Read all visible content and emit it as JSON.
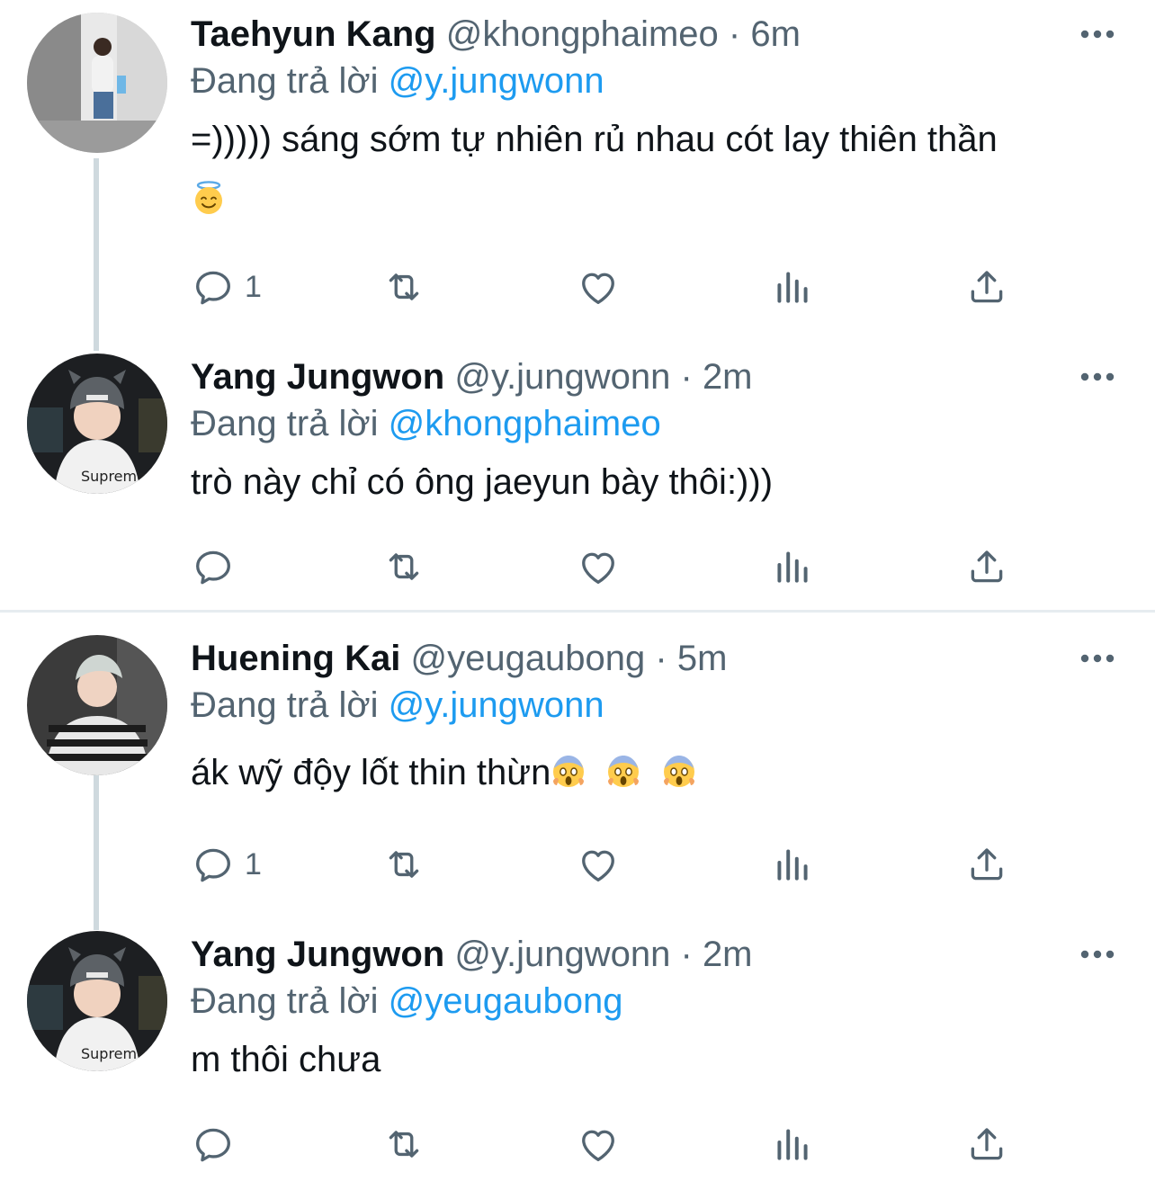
{
  "reply_prefix": "Đang trả lời",
  "tweets": [
    {
      "name": "Taehyun Kang",
      "handle": "@khongphaimeo",
      "separator": "·",
      "time": "6m",
      "reply_to": "@y.jungwonn",
      "text": "=))))) sáng sớm tự nhiên rủ nhau cót lay thiên thần",
      "emoji": "smiling-face-with-halo",
      "reply_count": "1"
    },
    {
      "name": "Yang Jungwon",
      "handle": "@y.jungwonn",
      "separator": "·",
      "time": "2m",
      "reply_to": "@khongphaimeo",
      "text": "trò này chỉ có ông jaeyun bày thôi:)))",
      "reply_count": ""
    },
    {
      "name": "Huening Kai",
      "handle": "@yeugaubong",
      "separator": "·",
      "time": "5m",
      "reply_to": "@y.jungwonn",
      "text": "ák wỹ độy lốt thin thừn",
      "emoji": "face-screaming-in-fear x3",
      "reply_count": "1"
    },
    {
      "name": "Yang Jungwon",
      "handle": "@y.jungwonn",
      "separator": "·",
      "time": "2m",
      "reply_to": "@yeugaubong",
      "text": "m thôi chưa",
      "reply_count": ""
    }
  ],
  "icons": {
    "reply": "reply-icon",
    "retweet": "retweet-icon",
    "like": "heart-icon",
    "stats": "analytics-icon",
    "share": "share-icon",
    "more": "more-options-icon"
  },
  "colors": {
    "link": "#1d9bf0",
    "secondary_text": "#536471",
    "thread_line": "#cfd9de",
    "divider": "#e6ecf0"
  }
}
